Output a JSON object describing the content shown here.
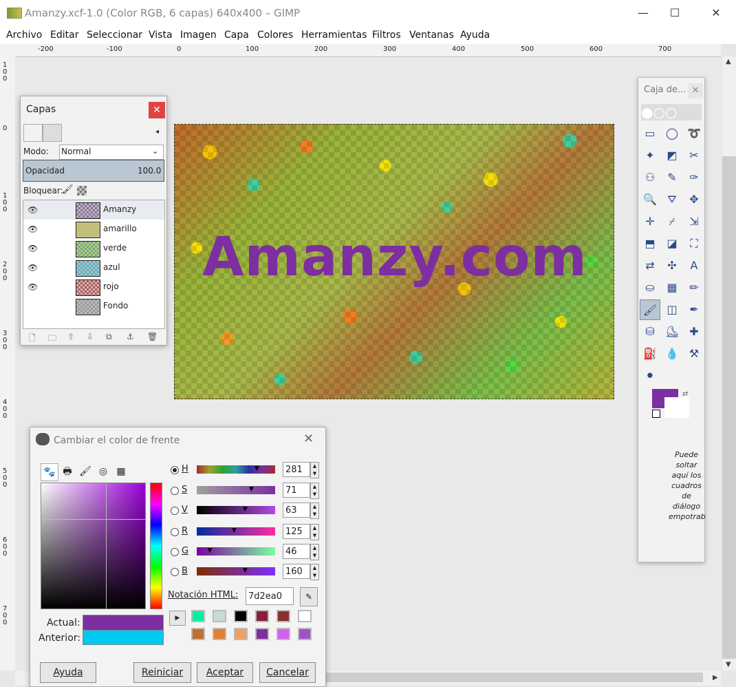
{
  "window": {
    "title": "Amanzy.xcf-1.0 (Color RGB, 6 capas) 640x400 – GIMP",
    "controls": {
      "minimize": "—",
      "maximize": "☐",
      "close": "✕"
    }
  },
  "menu": [
    "Archivo",
    "Editar",
    "Seleccionar",
    "Vista",
    "Imagen",
    "Capa",
    "Colores",
    "Herramientas",
    "Filtros",
    "Ventanas",
    "Ayuda"
  ],
  "ruler": {
    "h_labels": [
      "-200",
      "-100",
      "0",
      "100",
      "200",
      "300",
      "400",
      "500",
      "600",
      "700"
    ],
    "v_labels": [
      "1\n0\n0",
      "0",
      "1\n0\n0",
      "2\n0\n0",
      "3\n0\n0",
      "4\n0\n0",
      "5\n0\n0",
      "6\n0\n0",
      "7\n0\n0"
    ]
  },
  "image": {
    "text": "Amanzy.com",
    "text_color": "#7d2ea0"
  },
  "layers_dialog": {
    "title": "Capas",
    "close": "✕",
    "mode_label": "Modo:",
    "mode_value": "Normal",
    "opacity_label": "Opacidad",
    "opacity_value": "100.0",
    "lock_label": "Bloquear:",
    "layers": [
      {
        "name": "Amanzy",
        "visible": true,
        "swatch": "#8a6fa0"
      },
      {
        "name": "amarillo",
        "visible": true,
        "swatch": "#c8c23a"
      },
      {
        "name": "verde",
        "visible": true,
        "swatch": "#6fb84a"
      },
      {
        "name": "azul",
        "visible": true,
        "swatch": "#4ab8c8"
      },
      {
        "name": "rojo",
        "visible": true,
        "swatch": "#c85050"
      },
      {
        "name": "Fondo",
        "visible": false,
        "swatch": "#999999"
      }
    ]
  },
  "color_dialog": {
    "title": "Cambiar el color de frente",
    "close": "✕",
    "channels": [
      {
        "label": "H",
        "value": "281",
        "fraction": 0.78,
        "selected": true,
        "grad": "linear-gradient(90deg,#a02e2e,#a0a02e,#2ea02e,#2ea0a0,#2e2ea0,#7d2ea0,#a02e2e)"
      },
      {
        "label": "S",
        "value": "71",
        "fraction": 0.71,
        "selected": false,
        "grad": "linear-gradient(90deg,#a0a0a0,#7d2ea0)"
      },
      {
        "label": "V",
        "value": "63",
        "fraction": 0.63,
        "selected": false,
        "grad": "linear-gradient(90deg,#000,#b44ae6)"
      },
      {
        "label": "R",
        "value": "125",
        "fraction": 0.49,
        "selected": false,
        "grad": "linear-gradient(90deg,#002ea0,#ff2ea0)"
      },
      {
        "label": "G",
        "value": "46",
        "fraction": 0.18,
        "selected": false,
        "grad": "linear-gradient(90deg,#7d00a0,#7dffa0)"
      },
      {
        "label": "B",
        "value": "160",
        "fraction": 0.63,
        "selected": false,
        "grad": "linear-gradient(90deg,#7d2e00,#7d2eff)"
      }
    ],
    "html_label": "Notación HTML:",
    "html_value": "7d2ea0",
    "current_label": "Actual:",
    "previous_label": "Anterior:",
    "current_color": "#7d2ea0",
    "previous_color": "#00c8f0",
    "history": [
      "#00f0a0",
      "#c8dcd0",
      "#000000",
      "#8a1e3a",
      "#8a3030",
      "#ffffff",
      "#c07030",
      "#e08030",
      "#f0a060",
      "#7d2ea0",
      "#d060f0",
      "#a050c8"
    ],
    "buttons": {
      "help": "Ayuda",
      "reset": "Reiniciar",
      "ok": "Aceptar",
      "cancel": "Cancelar"
    }
  },
  "toolbox": {
    "title": "Caja de...",
    "close": "✕",
    "fg_color": "#7d2ea0",
    "bg_color": "#ffffff",
    "hint": "Puede soltar aquí los cuadros de diálogo empotrab"
  }
}
